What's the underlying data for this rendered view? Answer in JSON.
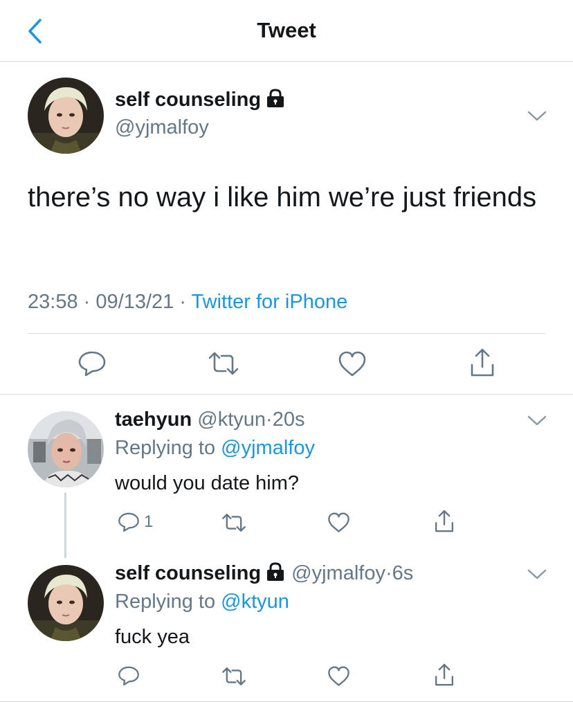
{
  "header": {
    "title": "Tweet",
    "back_icon": "chevron-left-icon"
  },
  "colors": {
    "accent": "#1b95e0",
    "gray": "#657786",
    "text": "#14171a",
    "divider": "#d8dde1"
  },
  "main_tweet": {
    "name": "self counseling",
    "handle": "@yjmalfoy",
    "text": "there’s no way i like him we’re just friends",
    "time": "23:58",
    "date": "09/13/21",
    "source": "Twitter for iPhone",
    "sep": "·"
  },
  "replies": [
    {
      "name": "taehyun",
      "handle": "@ktyun",
      "time": "20s",
      "replying_prefix": "Replying to",
      "replying_to": "@yjmalfoy",
      "text": "would you date him?",
      "reply_count": "1"
    },
    {
      "name": "self counseling",
      "handle": "@yjmalfoy",
      "time": "6s",
      "replying_prefix": "Replying to",
      "replying_to": "@ktyun",
      "text": "fuck yea",
      "reply_count": ""
    }
  ]
}
